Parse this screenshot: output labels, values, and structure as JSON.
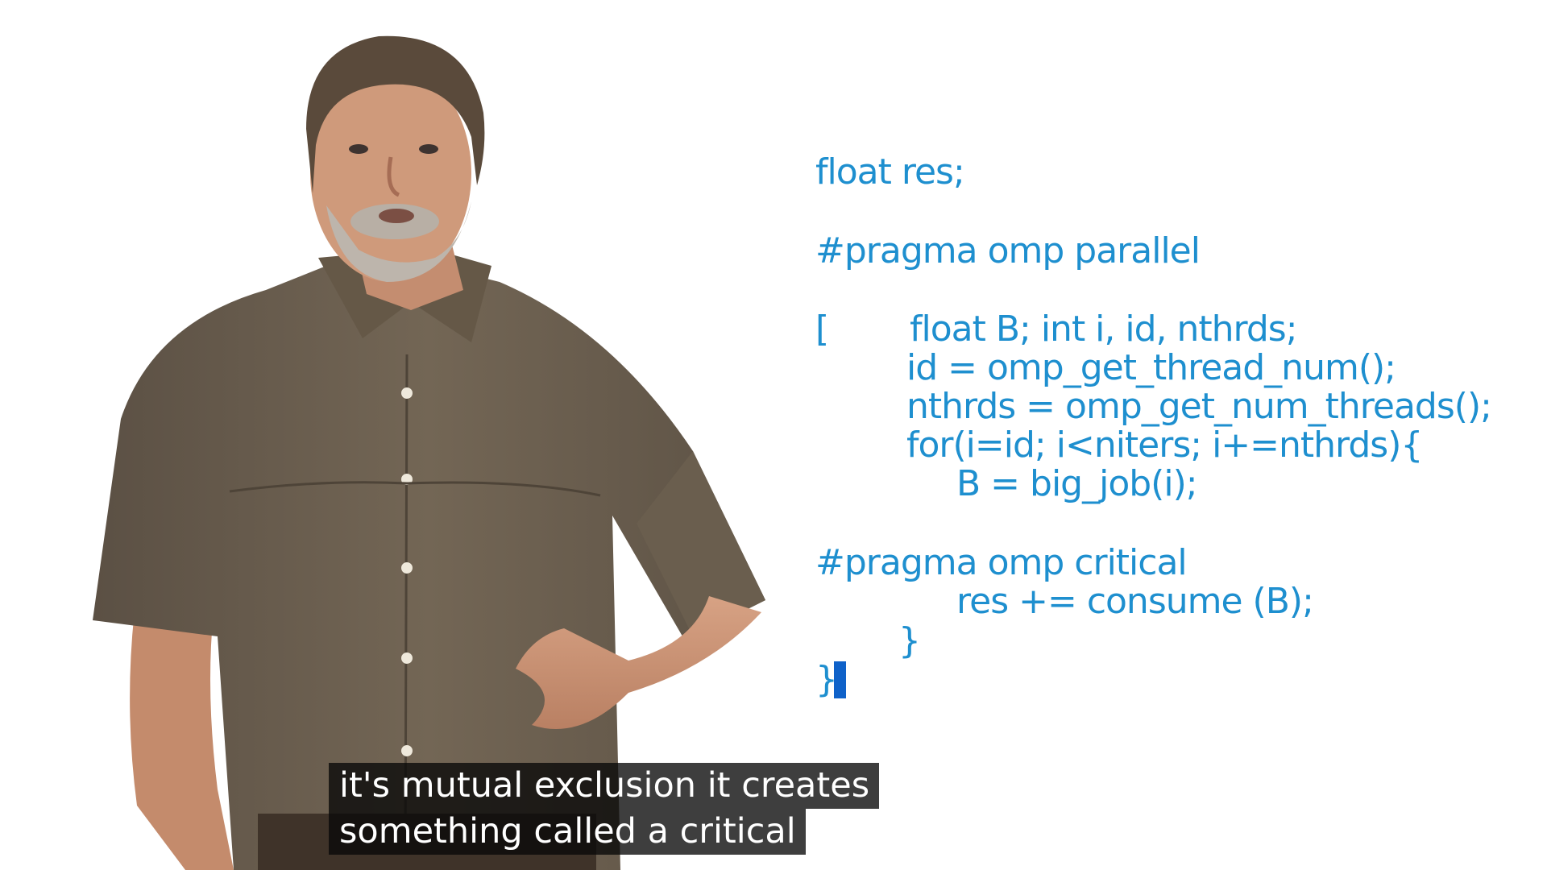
{
  "code": {
    "lines": [
      "float res;",
      "#pragma omp parallel",
      "[",
      "float B; int i, id, nthrds;",
      "id = omp_get_thread_num();",
      "nthrds = omp_get_num_threads();",
      "for(i=id; i<niters; i+=nthrds){",
      "B = big_job(i);",
      "#pragma omp critical",
      "res += consume (B);",
      "}",
      "}"
    ],
    "color": "#1e8fcf",
    "cursor_color": "#0f62c9"
  },
  "captions": {
    "line1": "it's mutual exclusion it creates",
    "line2": "something called a critical"
  },
  "speaker": {
    "shirt_color": "#6b5f4f",
    "background_color": "#ffffff"
  }
}
